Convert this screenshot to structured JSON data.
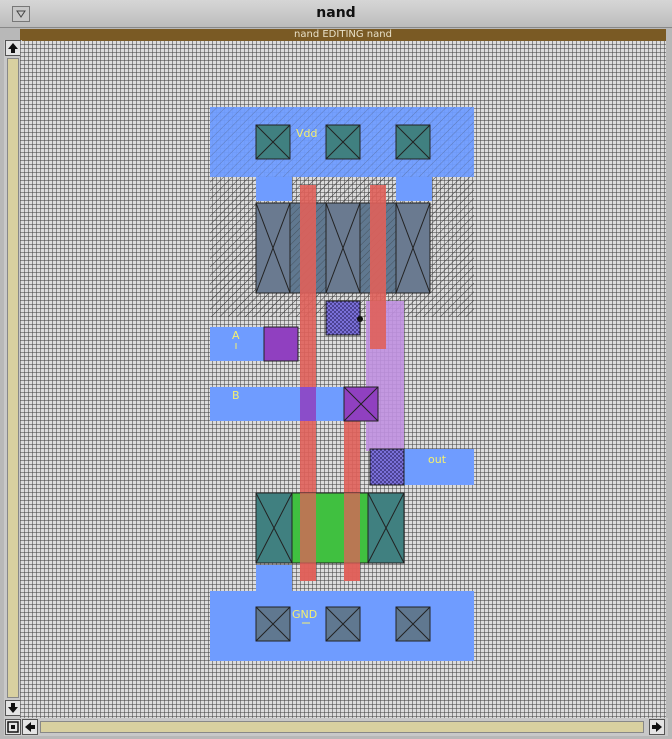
{
  "window": {
    "title": "nand",
    "menu_icon": "window-menu-icon"
  },
  "editbar": {
    "text": "nand EDITING nand"
  },
  "canvas": {
    "labels": {
      "vdd": "Vdd",
      "a": "A",
      "b": "B",
      "out": "out",
      "gnd": "GND"
    }
  },
  "colors": {
    "metal1": "#6f9cff",
    "poly": "#e0605a",
    "diffusion_p": "#607890",
    "diffusion_n": "#40c040",
    "contact": "#408080",
    "via": "#9040c0",
    "metal2": "#c090e0",
    "label": "#f4f070"
  },
  "icons": {
    "scroll_up": "arrow-up-icon",
    "scroll_down": "arrow-down-icon",
    "scroll_left": "arrow-left-icon",
    "scroll_right": "arrow-right-icon",
    "corner": "corner-box-icon"
  }
}
